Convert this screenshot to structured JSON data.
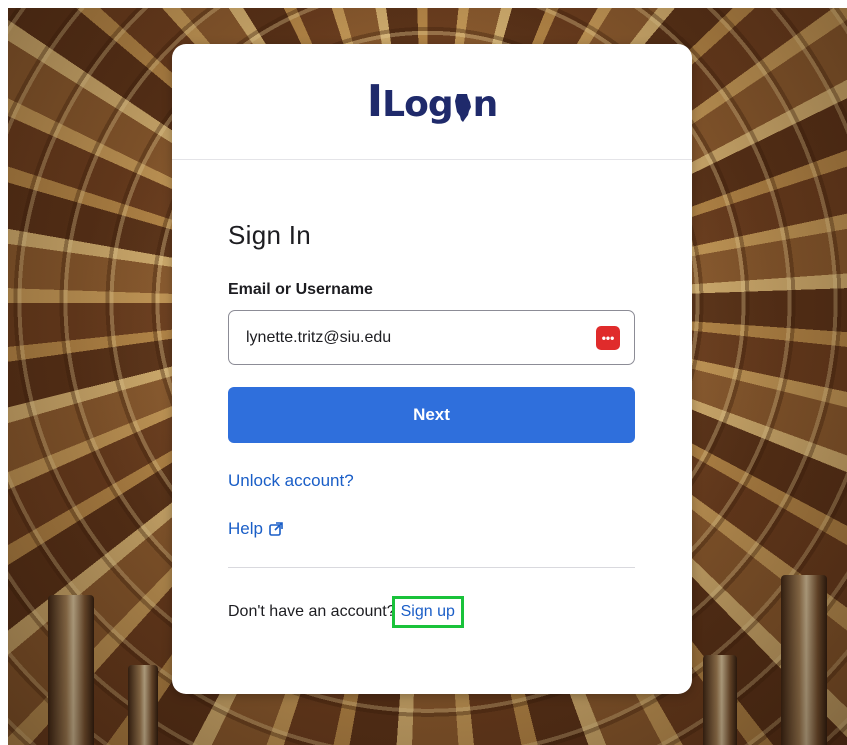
{
  "logo": {
    "text_I": "I",
    "text_rest_1": "Log",
    "text_rest_2": "n"
  },
  "signin": {
    "title": "Sign In",
    "field_label": "Email or Username",
    "input_value": "lynette.tritz@siu.edu",
    "password_manager_icon": "password-manager-icon",
    "next_label": "Next",
    "unlock_label": "Unlock account?",
    "help_label": "Help",
    "no_account_text": "Don't have an account?",
    "signup_label": "Sign up"
  },
  "colors": {
    "primary_button": "#2f6fdc",
    "link": "#1a5ec7",
    "logo": "#1f2a6b",
    "highlight_box": "#19c23a",
    "password_manager": "#e02b2b"
  }
}
